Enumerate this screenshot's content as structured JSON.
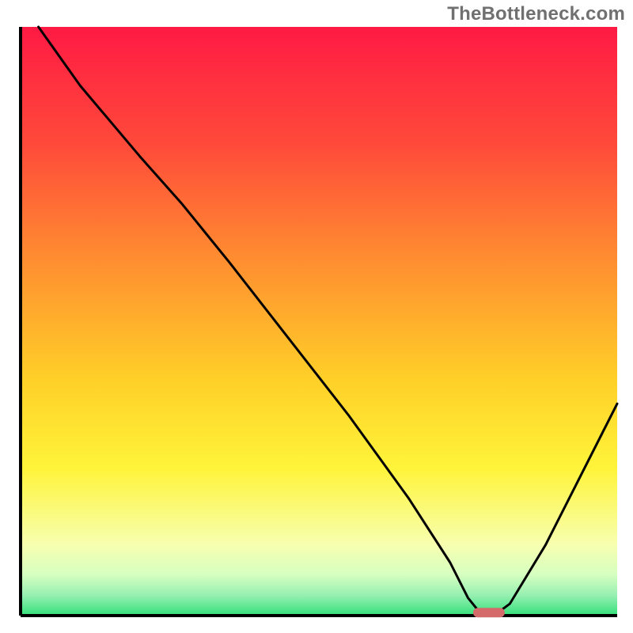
{
  "watermark": "TheBottleneck.com",
  "chart_data": {
    "type": "line",
    "title": "",
    "xlabel": "",
    "ylabel": "",
    "xlim": [
      0,
      100
    ],
    "ylim": [
      0,
      100
    ],
    "grid": false,
    "legend": false,
    "description": "V-shaped bottleneck curve over a vertical heat gradient (red→orange→yellow→green). Lower y = better (green band at bottom). Minimum around x≈77–80 where curve touches the green band; a short red marker sits at the trough.",
    "gradient_stops": [
      {
        "pct": 0.0,
        "color": "#ff1a44"
      },
      {
        "pct": 0.2,
        "color": "#ff4a3a"
      },
      {
        "pct": 0.4,
        "color": "#ff8f30"
      },
      {
        "pct": 0.6,
        "color": "#ffd028"
      },
      {
        "pct": 0.75,
        "color": "#fff43a"
      },
      {
        "pct": 0.88,
        "color": "#f7ffb0"
      },
      {
        "pct": 0.93,
        "color": "#d6ffc0"
      },
      {
        "pct": 0.965,
        "color": "#97f0b2"
      },
      {
        "pct": 1.0,
        "color": "#34e07a"
      }
    ],
    "series": [
      {
        "name": "bottleneck-curve",
        "x": [
          3,
          10,
          20,
          27,
          35,
          45,
          55,
          65,
          72,
          75,
          77,
          80,
          82,
          88,
          95,
          100
        ],
        "y": [
          100,
          90,
          78,
          70,
          60,
          47,
          34,
          20,
          9,
          3,
          0.5,
          0.5,
          2,
          12,
          26,
          36
        ]
      }
    ],
    "marker": {
      "x": 78.5,
      "y": 0.5,
      "color": "#d46a6a"
    }
  }
}
